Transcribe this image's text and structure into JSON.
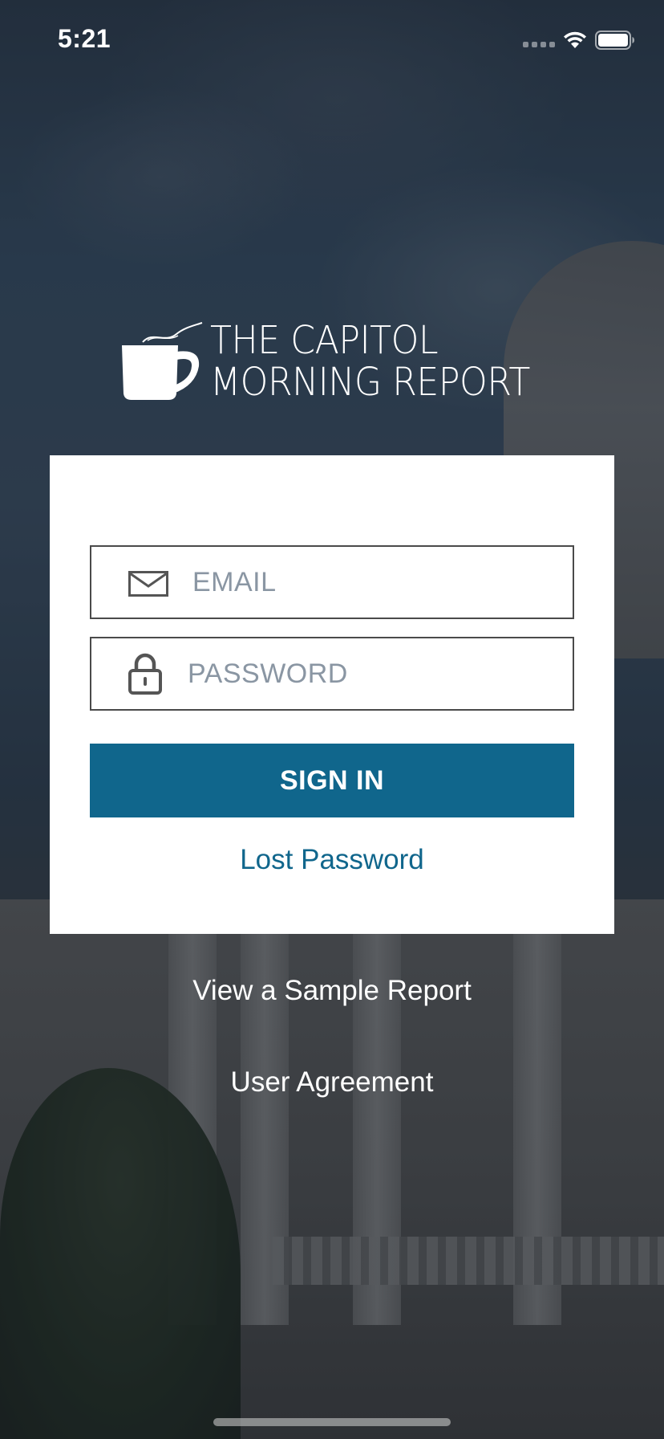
{
  "status_bar": {
    "time": "5:21"
  },
  "logo": {
    "line1": "THE CAPITOL",
    "line2": "MORNING REPORT",
    "icon": "coffee-mug-icon"
  },
  "login_form": {
    "email_placeholder": "EMAIL",
    "email_value": "",
    "email_icon": "mail-icon",
    "password_placeholder": "PASSWORD",
    "password_value": "",
    "password_icon": "lock-icon",
    "sign_in_label": "SIGN IN",
    "lost_password_label": "Lost Password"
  },
  "footer": {
    "sample_report_label": "View a Sample Report",
    "user_agreement_label": "User Agreement"
  },
  "colors": {
    "accent": "#10668c",
    "card_background": "#ffffff",
    "placeholder": "#8a96a3"
  }
}
